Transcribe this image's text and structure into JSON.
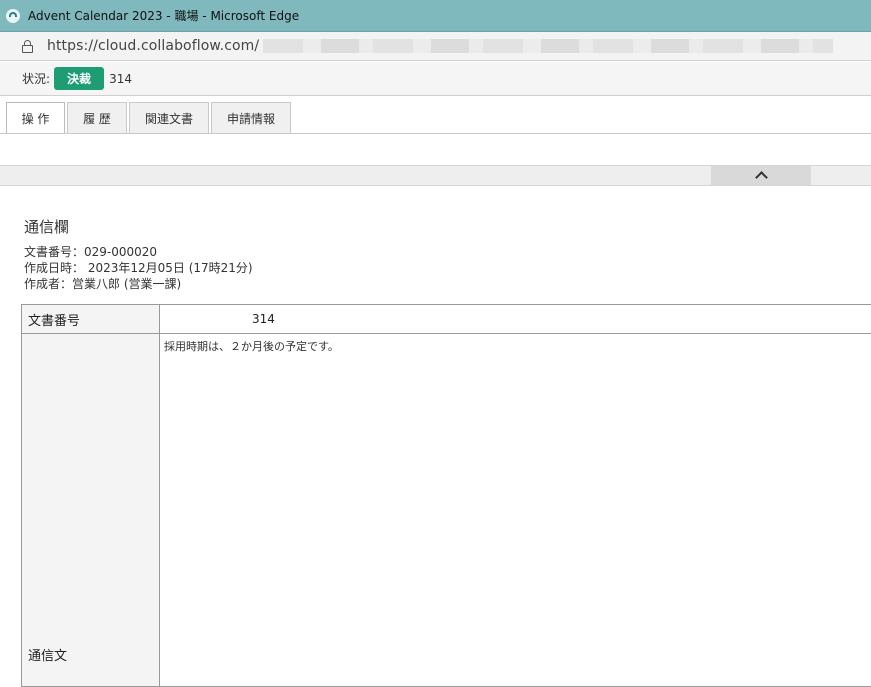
{
  "window": {
    "title": "Advent Calendar 2023 - 職場 - Microsoft Edge",
    "url": "https://cloud.collaboflow.com/"
  },
  "status": {
    "label": "状況:",
    "badge": "決裁",
    "doc_number": "314",
    "badge_color": "#1e9c73"
  },
  "tabs": [
    {
      "label": "操 作"
    },
    {
      "label": "履 歴"
    },
    {
      "label": "関連文書"
    },
    {
      "label": "申請情報"
    }
  ],
  "section": {
    "title": "通信欄",
    "doc_number_line": "文書番号：029-000020",
    "created_at_line": "作成日時： 2023年12月05日 (17時21分)",
    "author_line": "作成者：営業八郎 (営業一課)"
  },
  "form": {
    "rows": [
      {
        "label": "文書番号",
        "value": "314"
      },
      {
        "label": "通信文",
        "value": "採用時期は、２か月後の予定です。"
      }
    ]
  },
  "icons": {
    "browser": "edge-icon",
    "lock": "lock-icon",
    "collapse": "chevron-up-icon"
  }
}
